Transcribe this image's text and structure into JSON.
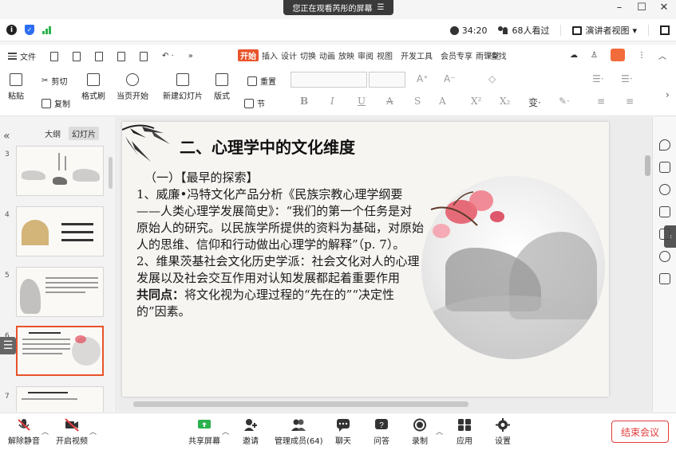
{
  "share_banner": {
    "text": "您正在观看芮彤的屏幕",
    "icon": "menu-lines-icon"
  },
  "window_controls": [
    "–",
    "☐",
    "✕"
  ],
  "status_bar": {
    "timer": "34:20",
    "viewers": "68人看过",
    "view_mode": "演讲者视图"
  },
  "ribbon": {
    "file_label": "文件",
    "active_tab": "开始",
    "tabs": [
      "插入",
      "设计",
      "切换",
      "动画",
      "放映",
      "审阅",
      "视图",
      "开发工具",
      "会员专享",
      "雨课堂"
    ],
    "search": "查找",
    "tools": {
      "paste": "粘贴",
      "cut": "剪切",
      "copy": "复制",
      "format_painter": "格式刷",
      "play_current": "当页开始",
      "new_slide": "新建幻灯片",
      "layout": "版式",
      "reset": "重置",
      "section": "节"
    },
    "format_buttons": [
      "B",
      "I",
      "U",
      "A",
      "S",
      "A",
      "X²",
      "X₂"
    ]
  },
  "left_panel": {
    "tabs": [
      "大纲",
      "幻灯片"
    ],
    "active_tab": "幻灯片",
    "thumbnails": [
      {
        "num": "3"
      },
      {
        "num": "4"
      },
      {
        "num": "5"
      },
      {
        "num": "6",
        "active": true
      },
      {
        "num": "7"
      }
    ]
  },
  "slide": {
    "title": "二、心理学中的文化维度",
    "heading": "（一）【最早的探索】",
    "para1": "1、威廉•冯特文化产品分析《民族宗教心理学纲要——人类心理学发展简史》：“我们的第一个任务是对原始人的研究。以民族学所提供的资料为基础，对原始人的思维、信仰和行动做出心理学的解释”（p. 7）。",
    "para2": "2、维果茨基社会文化历史学派：社会文化对人的心理发展以及社会交互作用对认知发展都起着重要作用",
    "common_label": "共同点：",
    "common_text": "将文化视为心理过程的“先在的”“决定性的”因素。"
  },
  "bottom_bar": {
    "buttons": [
      {
        "label": "解除静音",
        "icon": "mic-muted-icon"
      },
      {
        "label": "开启视频",
        "icon": "video-off-icon"
      },
      {
        "label": "共享屏幕",
        "icon": "share-screen-icon"
      },
      {
        "label": "邀请",
        "icon": "invite-icon"
      },
      {
        "label": "管理成员(64)",
        "icon": "members-icon"
      },
      {
        "label": "聊天",
        "icon": "chat-icon"
      },
      {
        "label": "问答",
        "icon": "qa-icon"
      },
      {
        "label": "录制",
        "icon": "record-icon"
      },
      {
        "label": "应用",
        "icon": "apps-icon"
      },
      {
        "label": "设置",
        "icon": "gear-icon"
      }
    ],
    "end_meeting": "结束会议"
  },
  "colors": {
    "accent": "#e8532a",
    "end_red": "#e23b3b",
    "signal_green": "#2bb24c",
    "shield_blue": "#2c6df0"
  }
}
